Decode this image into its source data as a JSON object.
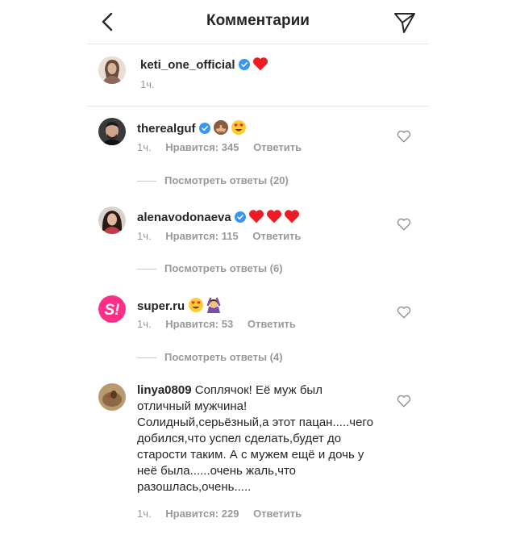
{
  "header": {
    "title": "Комментарии"
  },
  "caption": {
    "username": "keti_one_official",
    "time": "1ч."
  },
  "comments": [
    {
      "username": "therealguf",
      "time": "1ч.",
      "likes": "Нравится: 345",
      "reply": "Ответить",
      "view_replies": "Посмотреть ответы (20)"
    },
    {
      "username": "alenavodonaeva",
      "time": "1ч.",
      "likes": "Нравится: 115",
      "reply": "Ответить",
      "view_replies": "Посмотреть ответы (6)"
    },
    {
      "username": "super.ru",
      "time": "1ч.",
      "likes": "Нравится: 53",
      "reply": "Ответить",
      "view_replies": "Посмотреть ответы (4)"
    },
    {
      "username": "linya0809",
      "text": "Соплячок! Её муж был отличный мужчина! Солидный,серьёзный,а этот пацан.....чего добился,что успел сделать,будет до старости таким. А с мужем ещё и дочь у неё была......очень жаль,что разошлась,очень.....",
      "time": "1ч.",
      "likes": "Нравится: 229",
      "reply": "Ответить"
    }
  ],
  "colors": {
    "verified": "#3897f0",
    "heart": "#ed4956",
    "super_brand": "#ff2e87"
  }
}
